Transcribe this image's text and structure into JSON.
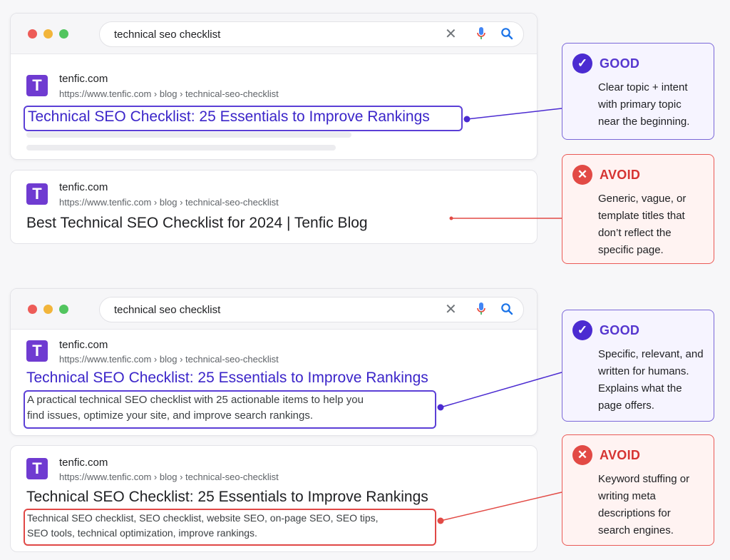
{
  "search": {
    "query": "technical seo checklist"
  },
  "result": {
    "site": "tenfic.com",
    "logo_letter": "T",
    "url": "https://www.tenfic.com › blog › technical-seo-checklist"
  },
  "examples": {
    "good_title": "Technical SEO Checklist: 25 Essentials to Improve Rankings",
    "bad_title": "Best Technical SEO Checklist for 2024 | Tenfic Blog",
    "good_desc_title": "Technical SEO Checklist: 25 Essentials to Improve Rankings",
    "good_desc_line1": "A practical technical SEO checklist with 25 actionable items to help you",
    "good_desc_line2": "find issues, optimize your site, and improve search rankings.",
    "bad_desc_title": "Technical SEO Checklist: 25 Essentials to Improve Rankings",
    "bad_desc_line1": "Technical SEO checklist, SEO checklist, website SEO, on-page SEO, SEO tips,",
    "bad_desc_line2": "SEO tools, technical optimization, improve rankings."
  },
  "callouts": {
    "good1": {
      "label": "GOOD",
      "text": "Clear topic + intent with primary topic near the beginning."
    },
    "avoid1": {
      "label": "AVOID",
      "text": "Generic, vague, or template titles that don’t reflect the specific page."
    },
    "good2": {
      "label": "GOOD",
      "text": "Specific, relevant, and written for humans. Explains what the page offers."
    },
    "avoid2": {
      "label": "AVOID",
      "text": "Keyword stuffing or writing meta descriptions for search engines."
    }
  },
  "colors": {
    "good": "#5536cf",
    "avoid": "#d63432"
  },
  "icons": {
    "good": "check-icon",
    "avoid": "x-icon"
  }
}
